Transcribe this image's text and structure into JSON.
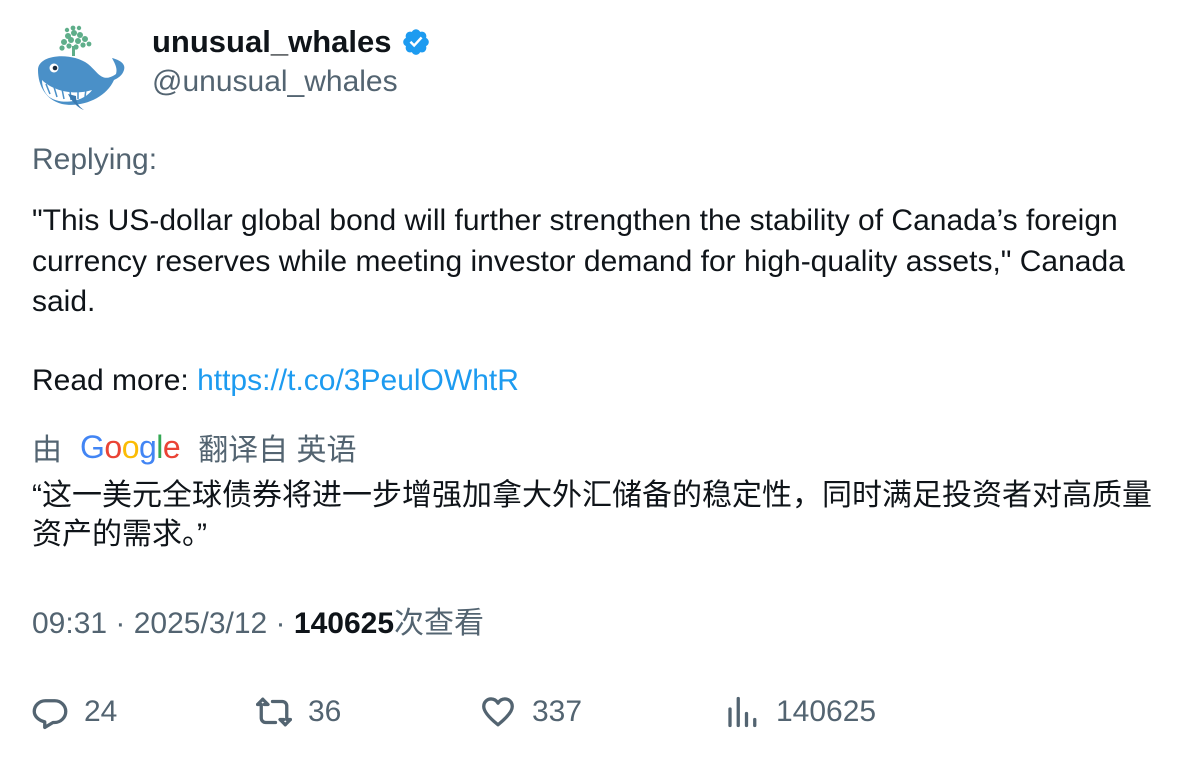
{
  "author": {
    "display_name": "unusual_whales",
    "handle": "@unusual_whales",
    "verified": true,
    "verified_color": "#1d9bf0",
    "avatar_icon": "whale-avatar-icon"
  },
  "tweet": {
    "replying_label": "Replying:",
    "text": "\"This US-dollar global bond will further strengthen the stability of Canada’s foreign currency reserves while meeting investor demand for high-quality assets,\" Canada said.",
    "read_more_label": "Read more: ",
    "link": "https://t.co/3PeulOWhtR"
  },
  "translation": {
    "prefix": "由",
    "provider_logo": "Google",
    "suffix": "翻译自 英语",
    "text": "“这一美元全球债券将进一步增强加拿大外汇储备的稳定性，同时满足投资者对高质量资产的需求。”"
  },
  "meta": {
    "time": "09:31",
    "separator": " · ",
    "date": "2025/3/12",
    "views_count": "140625",
    "views_label": "次查看"
  },
  "actions": {
    "reply_count": "24",
    "retweet_count": "36",
    "like_count": "337",
    "views_count": "140625"
  },
  "colors": {
    "text_primary": "#0f1419",
    "text_secondary": "#536471",
    "link": "#1d9bf0"
  }
}
